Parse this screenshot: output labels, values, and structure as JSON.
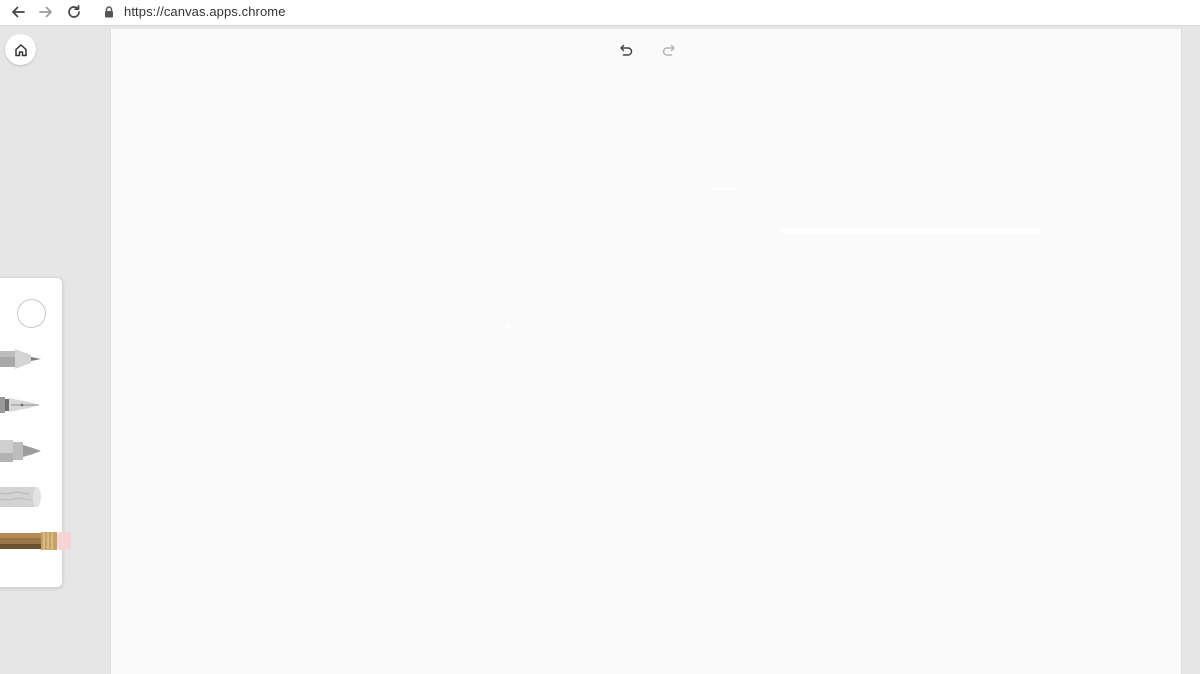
{
  "browser": {
    "url": "https://canvas.apps.chrome",
    "icons": {
      "back": "arrow-left-icon",
      "forward": "arrow-right-icon",
      "reload": "reload-icon",
      "lock": "lock-icon"
    }
  },
  "sidebar": {
    "home_icon": "home-icon"
  },
  "tools": [
    {
      "id": "color",
      "icon": "color-circle-icon"
    },
    {
      "id": "pen",
      "icon": "pen-icon"
    },
    {
      "id": "calligraphy",
      "icon": "fountain-pen-icon"
    },
    {
      "id": "marker",
      "icon": "marker-icon"
    },
    {
      "id": "chalk",
      "icon": "chalk-icon"
    },
    {
      "id": "pencil",
      "icon": "pencil-icon"
    }
  ],
  "canvas": {
    "undo_icon": "undo-icon",
    "redo_icon": "redo-icon",
    "background": "#fafafa"
  },
  "colors": {
    "pencil_wood": "#9a7547",
    "pencil_eraser": "#f6d4d4",
    "tool_gray": "#a9a9a9"
  }
}
